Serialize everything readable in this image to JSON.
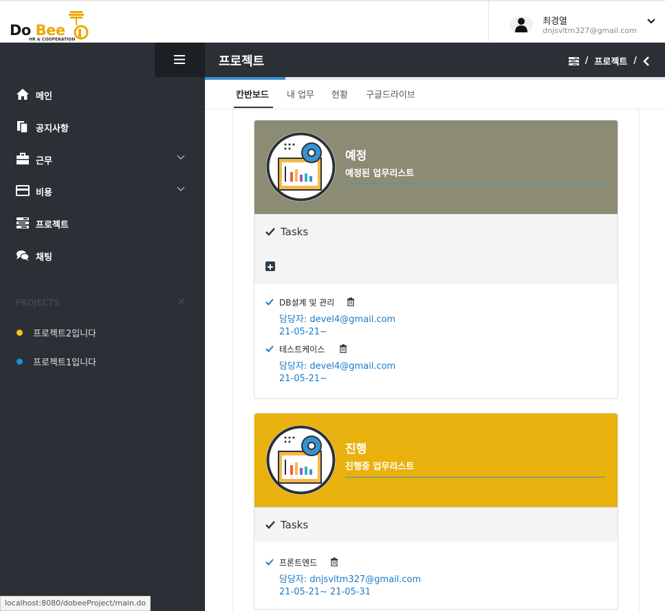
{
  "header": {
    "logo_text": "Do Bee",
    "logo_sub": "HR & COOPERATION",
    "user_name": "최경열",
    "user_email": "dnjsvltm327@gmail.com"
  },
  "sidebar": {
    "items": [
      {
        "label": "메인",
        "icon": "home-icon"
      },
      {
        "label": "공지사항",
        "icon": "documents-icon"
      },
      {
        "label": "근무",
        "icon": "briefcase-icon"
      },
      {
        "label": "비용",
        "icon": "credit-card-icon"
      },
      {
        "label": "프로젝트",
        "icon": "tasks-icon"
      },
      {
        "label": "채팅",
        "icon": "comments-icon"
      }
    ],
    "projects_header": "PROJECTS",
    "projects_close": "×",
    "projects": [
      {
        "label": "프로젝트2입니다",
        "color": "#f5c518"
      },
      {
        "label": "프로젝트1입니다",
        "color": "#1e8fd6"
      }
    ]
  },
  "page": {
    "title": "프로젝트",
    "breadcrumb": {
      "sep": "/",
      "current": "프로젝트"
    }
  },
  "tabs": [
    "칸반보드",
    "내 업무",
    "현황",
    "구글드라이브"
  ],
  "boards": [
    {
      "title": "예정",
      "subtitle": "예정된 업무리스트",
      "color": "#8c8b73",
      "tasks_label": "Tasks",
      "tasks": [
        {
          "name": "DB설계 및 관리",
          "assignee": "담당자: devel4@gmail.com",
          "date": "21-05-21~"
        },
        {
          "name": "테스트케이스",
          "assignee": "담당자: devel4@gmail.com",
          "date": "21-05-21~"
        }
      ]
    },
    {
      "title": "진행",
      "subtitle": "진행중 업무리스트",
      "color": "#e8b10d",
      "tasks_label": "Tasks",
      "tasks": [
        {
          "name": "프론트엔드",
          "assignee": "담당자: dnjsvltm327@gmail.com",
          "date": "21-05-21~ 21-05-31"
        }
      ]
    }
  ],
  "status_url": "localhost:8080/dobeeProject/main.do"
}
